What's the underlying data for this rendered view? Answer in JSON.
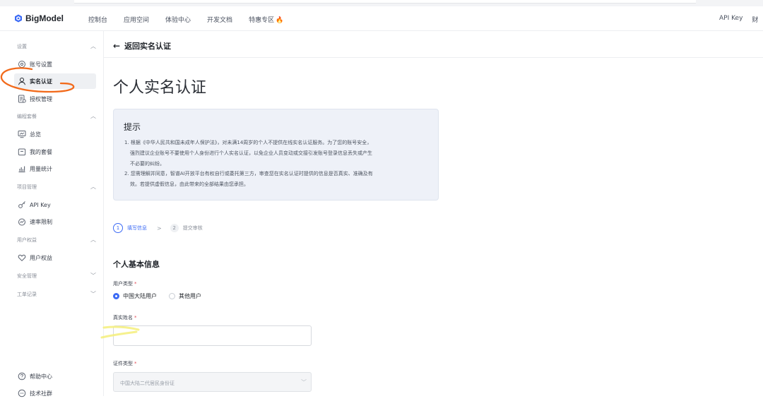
{
  "brand": {
    "name": "BigModel",
    "accent": "#3b6af5",
    "logo_icon": "hexagon-logo-icon"
  },
  "header": {
    "nav": [
      {
        "label": "控制台"
      },
      {
        "label": "应用空间"
      },
      {
        "label": "体验中心"
      },
      {
        "label": "开发文档"
      },
      {
        "label": "特惠专区",
        "icon": "fire-icon"
      }
    ],
    "right": {
      "api_key": "API Key",
      "truncated": "财"
    }
  },
  "sidebar": {
    "groups": [
      {
        "label": "设置",
        "expanded": true,
        "items": [
          {
            "label": "账号设置",
            "icon": "gear-icon"
          },
          {
            "label": "实名认证",
            "icon": "user-icon",
            "active": true
          },
          {
            "label": "授权管理",
            "icon": "auth-doc-icon"
          }
        ]
      },
      {
        "label": "编程套餐",
        "expanded": true,
        "items": [
          {
            "label": "总览",
            "icon": "overview-icon"
          },
          {
            "label": "我的套餐",
            "icon": "package-icon"
          },
          {
            "label": "用量统计",
            "icon": "stats-icon"
          }
        ]
      },
      {
        "label": "项目管理",
        "expanded": true,
        "items": [
          {
            "label": "API Key",
            "icon": "key-icon"
          },
          {
            "label": "速率限制",
            "icon": "gauge-icon"
          }
        ]
      },
      {
        "label": "用户权益",
        "expanded": true,
        "items": [
          {
            "label": "用户权益",
            "icon": "heart-icon"
          }
        ]
      },
      {
        "label": "安全管理",
        "expanded": false,
        "items": []
      },
      {
        "label": "工单记录",
        "expanded": false,
        "items": []
      }
    ],
    "bottom": [
      {
        "label": "帮助中心",
        "icon": "help-icon"
      },
      {
        "label": "技术社群",
        "icon": "community-icon"
      }
    ]
  },
  "main": {
    "back_label": "返回实名认证",
    "title": "个人实名认证",
    "notice": {
      "title": "提示",
      "lines": [
        "1. 根据《中华人民共和国未成年人保护法》，对未满14周岁的个人不提供在线实名认证服务。为了您的账号安全，",
        "强烈建议企业账号不要使用个人身份进行个人实名认证，以免企业人员变动或交接引发账号登录信息丢失或产生",
        "不必要的纠纷。",
        "2. 您需理解并同意，智谱AI开放平台有权自行或委托第三方，审查您在实名认证时提供的信息是否真实、准确及有",
        "效。若提供虚假信息，由此带来的全部结果由您承担。"
      ]
    },
    "steps": [
      {
        "num": "1",
        "label": "填写信息",
        "active": true
      },
      {
        "num": "2",
        "label": "提交审核",
        "active": false
      }
    ],
    "section_title": "个人基本信息",
    "form": {
      "user_type": {
        "label": "用户类型",
        "required": "*",
        "options": [
          {
            "label": "中国大陆用户",
            "checked": true
          },
          {
            "label": "其他用户",
            "checked": false
          }
        ]
      },
      "real_name": {
        "label": "真实姓名",
        "required": "*",
        "value": ""
      },
      "id_type": {
        "label": "证件类型",
        "required": "*",
        "value": "中国大陆二代居民身份证"
      }
    }
  }
}
